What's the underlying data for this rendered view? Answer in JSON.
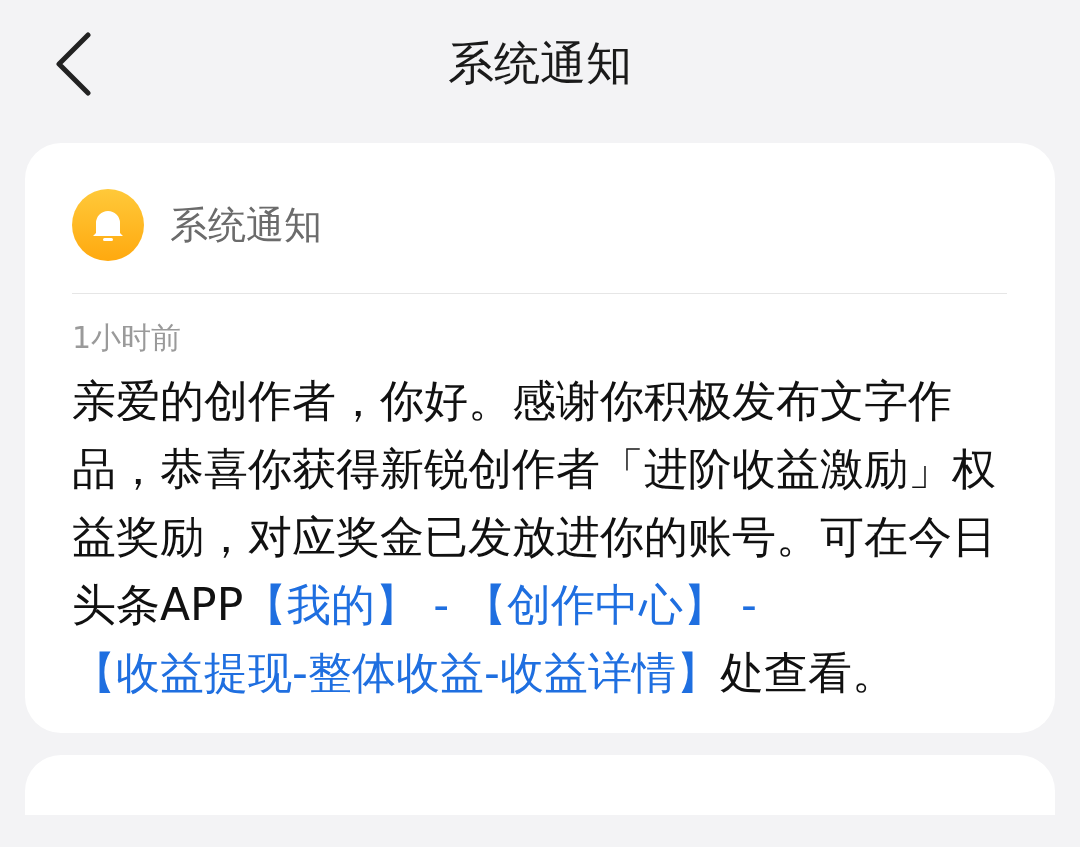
{
  "header": {
    "title": "系统通知"
  },
  "notice": {
    "sender": "系统通知",
    "time": "1小时前",
    "body": [
      {
        "kind": "text",
        "text": "亲爱的创作者，你好。感谢你积极发布文字作品，恭喜你获得新锐创作者「进阶收益激励」权益奖励，对应奖金已发放进你的账号。可在今日头条APP"
      },
      {
        "kind": "link",
        "text": "【我的】"
      },
      {
        "kind": "accent",
        "text": " - "
      },
      {
        "kind": "link",
        "text": "【创作中心】"
      },
      {
        "kind": "accent",
        "text": " - "
      },
      {
        "kind": "link",
        "text": "【收益提现-整体收益-收益详情】"
      },
      {
        "kind": "text",
        "text": "处查看。"
      }
    ]
  }
}
